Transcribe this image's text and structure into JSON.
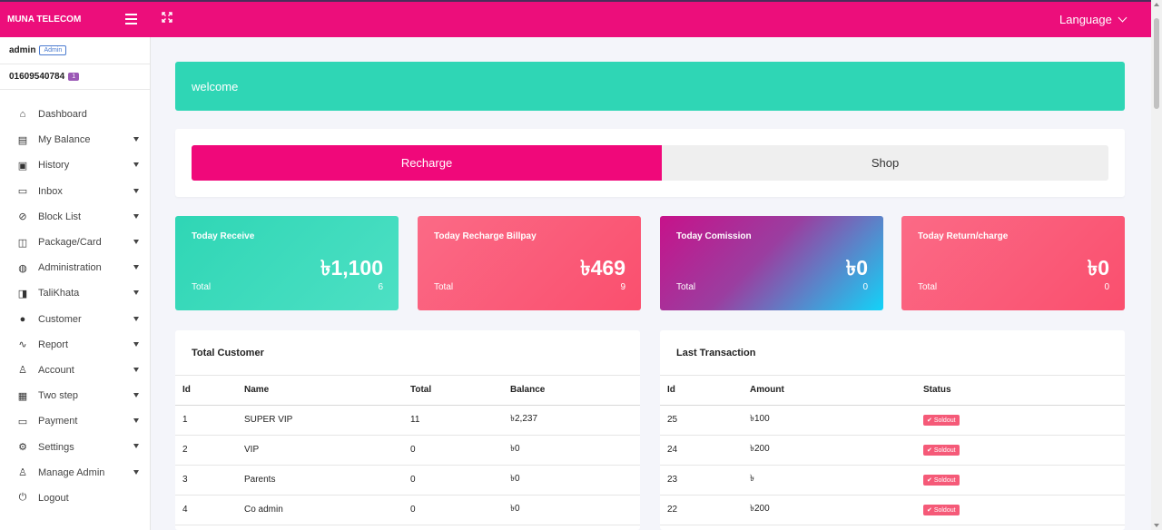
{
  "brand": "MUNA TELECOM",
  "header": {
    "language_label": "Language"
  },
  "user": {
    "name": "admin",
    "role": "Admin",
    "phone": "01609540784",
    "phone_badge": "1"
  },
  "sidebar": {
    "items": [
      {
        "label": "Dashboard",
        "icon": "home-icon",
        "glyph": "⌂",
        "has_caret": false
      },
      {
        "label": "My Balance",
        "icon": "wallet-icon",
        "glyph": "▤",
        "has_caret": true
      },
      {
        "label": "History",
        "icon": "book-icon",
        "glyph": "▣",
        "has_caret": true
      },
      {
        "label": "Inbox",
        "icon": "chat-icon",
        "glyph": "▭",
        "has_caret": true
      },
      {
        "label": "Block List",
        "icon": "block-icon",
        "glyph": "⊘",
        "has_caret": true
      },
      {
        "label": "Package/Card",
        "icon": "package-icon",
        "glyph": "◫",
        "has_caret": true
      },
      {
        "label": "Administration",
        "icon": "palette-icon",
        "glyph": "◍",
        "has_caret": true
      },
      {
        "label": "TaliKhata",
        "icon": "open-book-icon",
        "glyph": "◨",
        "has_caret": true
      },
      {
        "label": "Customer",
        "icon": "users-icon",
        "glyph": "●",
        "has_caret": true
      },
      {
        "label": "Report",
        "icon": "activity-icon",
        "glyph": "∿",
        "has_caret": true
      },
      {
        "label": "Account",
        "icon": "user-icon",
        "glyph": "♙",
        "has_caret": true
      },
      {
        "label": "Two step",
        "icon": "chart-icon",
        "glyph": "▦",
        "has_caret": true
      },
      {
        "label": "Payment",
        "icon": "payment-icon",
        "glyph": "▭",
        "has_caret": true
      },
      {
        "label": "Settings",
        "icon": "gear-icon",
        "glyph": "⚙",
        "has_caret": true
      },
      {
        "label": "Manage Admin",
        "icon": "user-icon",
        "glyph": "♙",
        "has_caret": true
      },
      {
        "label": "Logout",
        "icon": "power-icon",
        "glyph": "⏻",
        "has_caret": false
      }
    ]
  },
  "welcome": "welcome",
  "tabs": {
    "recharge": "Recharge",
    "shop": "Shop"
  },
  "stats": [
    {
      "title": "Today Receive",
      "value": "৳1,100",
      "label": "Total",
      "count": "6"
    },
    {
      "title": "Today Recharge Billpay",
      "value": "৳469",
      "label": "Total",
      "count": "9"
    },
    {
      "title": "Today Comission",
      "value": "৳0",
      "label": "Total",
      "count": "0"
    },
    {
      "title": "Today Return/charge",
      "value": "৳0",
      "label": "Total",
      "count": "0"
    }
  ],
  "customers": {
    "title": "Total Customer",
    "headers": [
      "Id",
      "Name",
      "Total",
      "Balance"
    ],
    "rows": [
      [
        "1",
        "SUPER VIP",
        "11",
        "৳2,237"
      ],
      [
        "2",
        "VIP",
        "0",
        "৳0"
      ],
      [
        "3",
        "Parents",
        "0",
        "৳0"
      ],
      [
        "4",
        "Co admin",
        "0",
        "৳0"
      ]
    ]
  },
  "transactions": {
    "title": "Last Transaction",
    "headers": [
      "Id",
      "Amount",
      "Status"
    ],
    "rows": [
      [
        "25",
        "৳100",
        "Soldout"
      ],
      [
        "24",
        "৳200",
        "Soldout"
      ],
      [
        "23",
        "৳",
        "Soldout"
      ],
      [
        "22",
        "৳200",
        "Soldout"
      ]
    ]
  },
  "colors": {
    "primary": "#ec0e7b",
    "teal": "#2fd6b5",
    "coral": "#fa5a78"
  }
}
